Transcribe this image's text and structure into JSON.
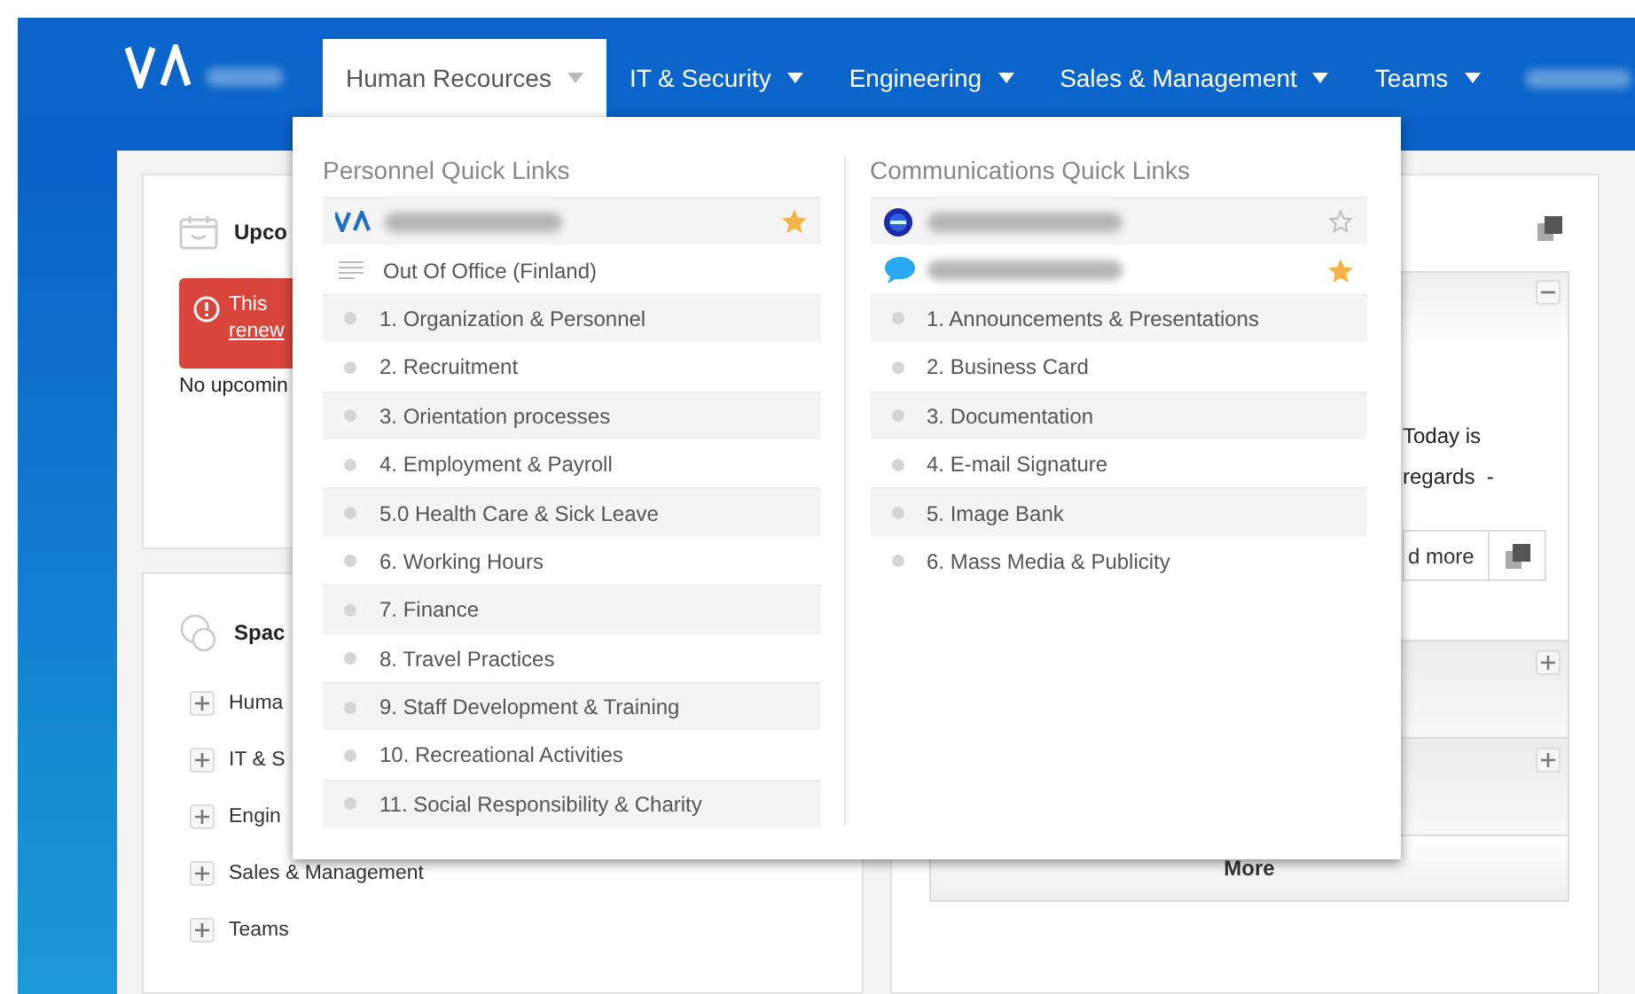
{
  "nav": {
    "items": [
      {
        "label": "Human Recources",
        "selected": true
      },
      {
        "label": "IT & Security",
        "selected": false
      },
      {
        "label": "Engineering",
        "selected": false
      },
      {
        "label": "Sales & Management",
        "selected": false
      },
      {
        "label": "Teams",
        "selected": false
      }
    ]
  },
  "dropdown": {
    "columns": [
      {
        "title": "Personnel Quick Links",
        "items": [
          {
            "kind": "logo",
            "starred": true
          },
          {
            "kind": "document",
            "label": "Out Of Office (Finland)"
          },
          {
            "kind": "bullet",
            "label": "1. Organization & Personnel"
          },
          {
            "kind": "bullet",
            "label": "2. Recruitment"
          },
          {
            "kind": "bullet",
            "label": "3. Orientation processes"
          },
          {
            "kind": "bullet",
            "label": "4. Employment & Payroll"
          },
          {
            "kind": "bullet",
            "label": "5.0 Health Care & Sick Leave"
          },
          {
            "kind": "bullet",
            "label": "6. Working Hours"
          },
          {
            "kind": "bullet",
            "label": "7. Finance"
          },
          {
            "kind": "bullet",
            "label": "8. Travel Practices"
          },
          {
            "kind": "bullet",
            "label": "9. Staff Development & Training"
          },
          {
            "kind": "bullet",
            "label": "10. Recreational Activities"
          },
          {
            "kind": "bullet",
            "label": "11. Social Responsibility & Charity"
          }
        ]
      },
      {
        "title": "Communications Quick Links",
        "items": [
          {
            "kind": "blog",
            "starred": false
          },
          {
            "kind": "chat",
            "starred": true
          },
          {
            "kind": "bullet",
            "label": "1. Announcements & Presentations"
          },
          {
            "kind": "bullet",
            "label": "2. Business Card"
          },
          {
            "kind": "bullet",
            "label": "3. Documentation"
          },
          {
            "kind": "bullet",
            "label": "4. E-mail Signature"
          },
          {
            "kind": "bullet",
            "label": "5. Image Bank"
          },
          {
            "kind": "bullet",
            "label": "6. Mass Media & Publicity"
          }
        ]
      }
    ]
  },
  "upcoming": {
    "title": "Upco",
    "alert": {
      "text": "This",
      "link": "renew"
    },
    "empty": "No upcomin"
  },
  "spaces": {
    "title": "Spac",
    "items": [
      {
        "label": "Huma"
      },
      {
        "label": "IT & S"
      },
      {
        "label": "Engin"
      },
      {
        "label": "Sales & Management"
      },
      {
        "label": "Teams"
      }
    ]
  },
  "feed": {
    "lines": [
      "Today is",
      "regards  -"
    ],
    "read_more": "d more",
    "sections": [
      {
        "expanded": false
      },
      {
        "expanded": false
      }
    ],
    "more": "More"
  }
}
